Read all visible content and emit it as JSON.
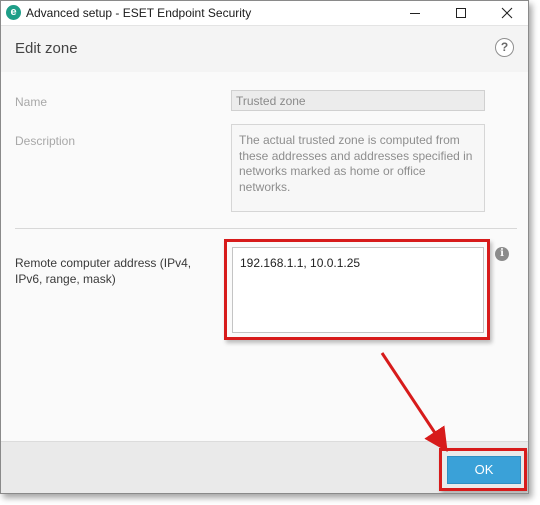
{
  "window": {
    "title": "Advanced setup - ESET Endpoint Security",
    "app_icon_letter": "e"
  },
  "header": {
    "title": "Edit zone",
    "help_glyph": "?"
  },
  "form": {
    "name_label": "Name",
    "name_value": "Trusted zone",
    "description_label": "Description",
    "description_value": "The actual trusted zone is computed from these addresses and addresses specified in networks marked as home or office networks.",
    "remote_label": "Remote computer address (IPv4, IPv6, range, mask)",
    "remote_value": "192.168.1.1, 10.0.1.25",
    "info_glyph": "i"
  },
  "footer": {
    "ok_label": "OK"
  },
  "colors": {
    "highlight": "#d71b1b",
    "ok_button": "#3aa1d8",
    "app_icon": "#1e9e88"
  },
  "icons": [
    "eset-logo-icon",
    "minimize-icon",
    "maximize-icon",
    "close-icon",
    "help-icon",
    "info-icon",
    "annotation-arrow"
  ]
}
